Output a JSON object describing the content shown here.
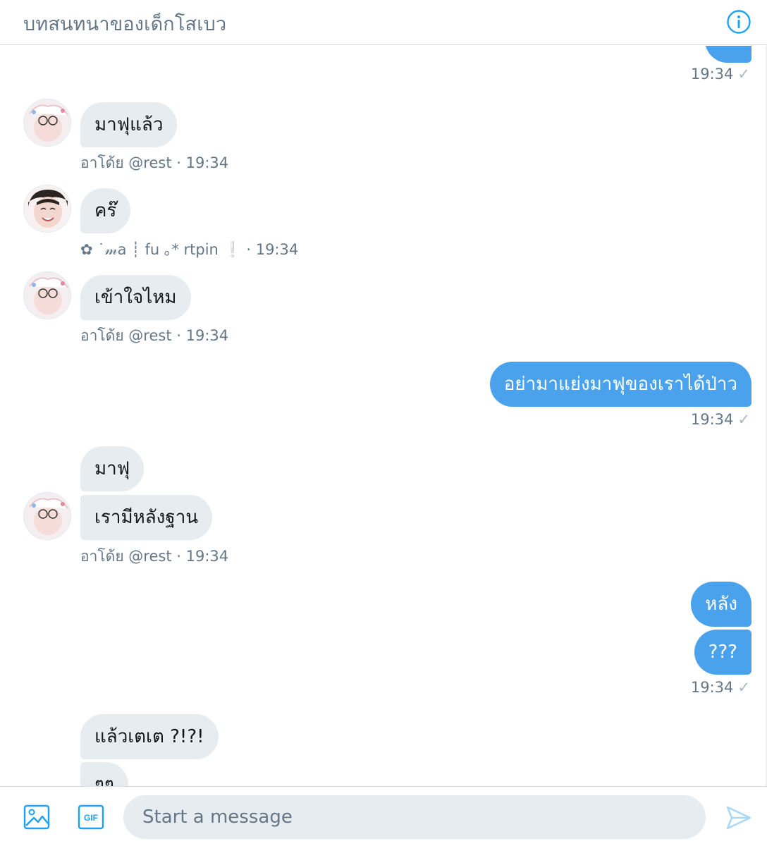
{
  "header": {
    "title": "บทสนทนาของเด็กโสเบว",
    "info_icon": "info-icon"
  },
  "messages": {
    "m0_time": "19:34",
    "m1_text": "มาฟุแล้ว",
    "m1_sender": "อาโด้ย @rest",
    "m1_time": "· 19:34",
    "m2_text": "คร๊",
    "m2_sender": "✿ ˙𝓂a ┊ fu ｡* rtpin ❕",
    "m2_time": "· 19:34",
    "m3_text": "เข้าใจไหม",
    "m3_sender": "อาโด้ย @rest",
    "m3_time": "· 19:34",
    "m4_text": "อย่ามาแย่งมาฟุของเราได้ป่าว",
    "m4_time": "19:34",
    "m5_text": "มาฟุ",
    "m6_text": "เรามีหลังฐาน",
    "m6_sender": "อาโด้ย @rest",
    "m6_time": "· 19:34",
    "m7_text": "หลัง",
    "m8_text": "???",
    "m8_time": "19:34",
    "m9_text": "แล้วเตเต ?!?!",
    "m10_text": "ๆๆ",
    "check": "✓"
  },
  "composer": {
    "placeholder": "Start a message",
    "media_icon": "image-icon",
    "gif_icon": "gif-icon",
    "send_icon": "send-icon"
  },
  "colors": {
    "accent": "#1da1f2",
    "bubble_out": "#4aa1ec",
    "bubble_in": "#e6ecf0",
    "meta": "#657786"
  }
}
